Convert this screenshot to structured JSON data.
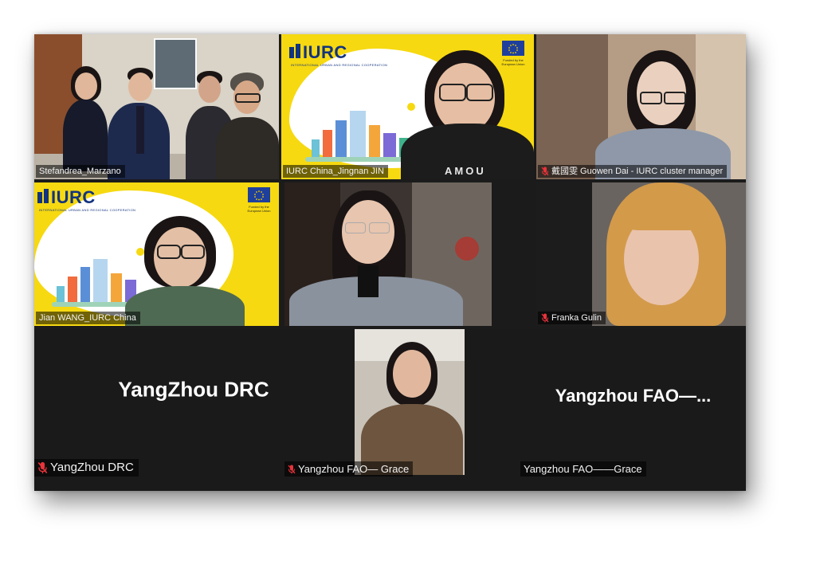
{
  "participants": [
    {
      "id": "p1",
      "name": "Stefandrea_Marzano",
      "muted": false
    },
    {
      "id": "p2",
      "name": "IURC China_Jingnan JIN",
      "muted": false
    },
    {
      "id": "p3",
      "name": "戴國雯 Guowen Dai - IURC cluster manager",
      "muted": true
    },
    {
      "id": "p4",
      "name": "Jian WANG_IURC China",
      "muted": false
    },
    {
      "id": "p5",
      "name": "",
      "muted": false
    },
    {
      "id": "p6",
      "name": "Franka Gulin",
      "muted": true
    },
    {
      "id": "p7",
      "name": "YangZhou DRC",
      "display": "YangZhou DRC",
      "muted": true
    },
    {
      "id": "p8",
      "name": "Yangzhou FAO— Grace",
      "muted": true
    },
    {
      "id": "p9",
      "name": "Yangzhou FAO——Grace",
      "display": "Yangzhou  FAO—...",
      "muted": false
    }
  ],
  "banner": {
    "logo_text": "IURC",
    "logo_sub": "INTERNATIONAL URBAN AND REGIONAL COOPERATION",
    "eu_text": "Funded by the European Union",
    "shirt_text": "AMOU"
  },
  "colors": {
    "banner_yellow": "#f6d911",
    "logo_blue": "#13337e",
    "eu_blue": "#1f3f9c",
    "active_border": "#f5e000",
    "mute_red": "#e8333a"
  },
  "icons": {
    "mic_muted": "mic-muted-icon"
  }
}
